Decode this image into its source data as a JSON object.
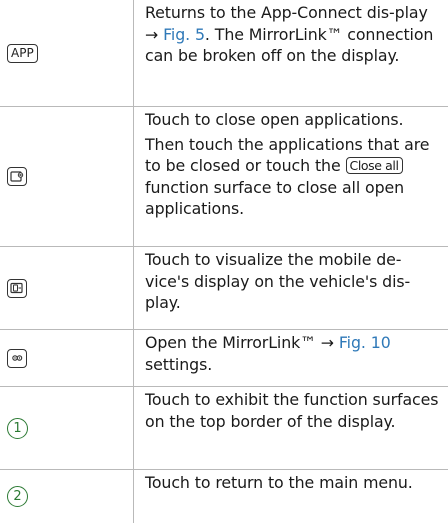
{
  "rows": [
    {
      "key_label": "APP",
      "text_a": "Returns to the App-Connect dis-play ",
      "arrow": "→",
      "link": "Fig. 5",
      "text_b": ". The MirrorLink™ connection can be broken off on the display."
    },
    {
      "icon": "close-apps-icon",
      "p1": "Touch to close open applications.",
      "p2_a": "Then touch the applications that are to be closed or touch the ",
      "button": "Close all",
      "p2_b": " function surface to close all open applications."
    },
    {
      "icon": "visualize-display-icon",
      "text": "Touch to visualize the mobile de-vice's display on the vehicle's dis-play."
    },
    {
      "icon": "settings-icon",
      "text_a": "Open the MirrorLink™ ",
      "arrow": "→",
      "link": "Fig. 10",
      "text_b": " settings."
    },
    {
      "marker": "1",
      "text": "Touch to exhibit the function surfaces on the top border of the display."
    },
    {
      "marker": "2",
      "text": "Touch to return to the main menu."
    }
  ],
  "colors": {
    "link": "#2f79b8",
    "marker": "#2c7a34",
    "rule": "#b9b9b9"
  }
}
